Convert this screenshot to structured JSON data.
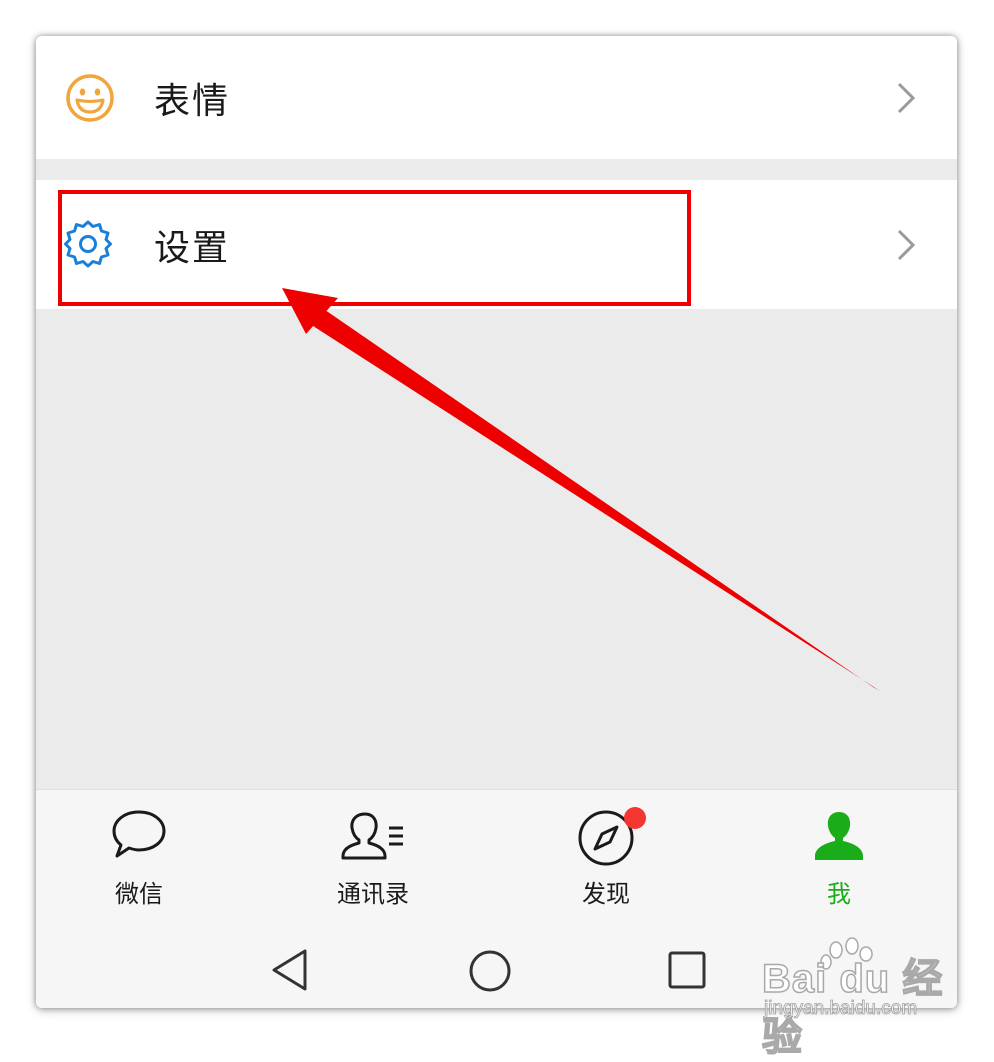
{
  "menu": {
    "items": [
      {
        "label": "表情",
        "icon": "smiley-icon"
      },
      {
        "label": "设置",
        "icon": "gear-icon"
      }
    ]
  },
  "tabbar": {
    "tabs": [
      {
        "label": "微信",
        "icon": "chat-bubble-icon",
        "active": false
      },
      {
        "label": "通讯录",
        "icon": "contacts-icon",
        "active": false
      },
      {
        "label": "发现",
        "icon": "compass-icon",
        "active": false,
        "badge": true
      },
      {
        "label": "我",
        "icon": "person-icon",
        "active": true
      }
    ]
  },
  "navbar": {
    "buttons": [
      "back-icon",
      "home-icon",
      "recents-icon"
    ]
  },
  "annotation": {
    "color": "#ee0000",
    "target": "设置"
  },
  "watermark": {
    "brand": "Bai du 经验",
    "url": "jingyan.baidu.com"
  },
  "colors": {
    "accent_green": "#1aad19",
    "emoji_orange": "#f0a63c",
    "gear_blue": "#1a7fd8",
    "badge_red": "#f43530"
  }
}
